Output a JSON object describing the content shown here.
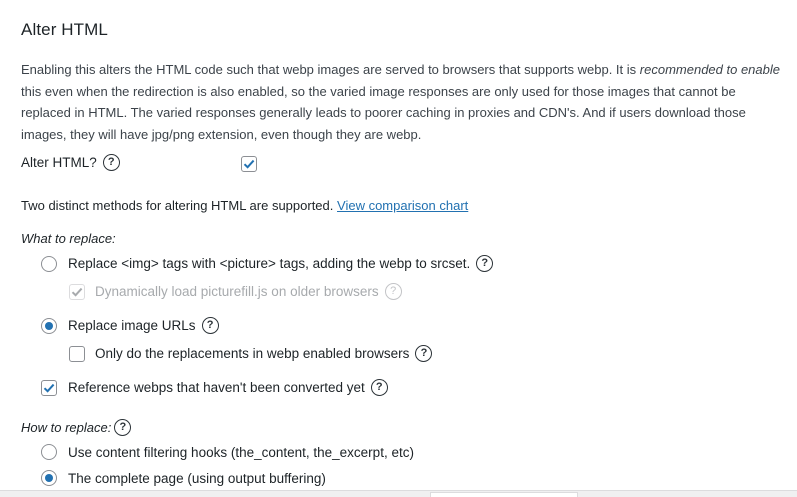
{
  "section": {
    "title": "Alter HTML",
    "description_parts": {
      "before": "Enabling this alters the HTML code such that webp images are served to browsers that supports webp. It is ",
      "emphasis": "recommended to enable",
      "after": " this even when the redirection is also enabled, so the varied image responses are only used for those images that cannot be replaced in HTML. The varied responses generally leads to poorer caching in proxies and CDN's. And if users download those images, they will have jpg/png extension, even though they are webp."
    }
  },
  "alter_html": {
    "label": "Alter HTML?",
    "help": "?",
    "checked": true
  },
  "methods": {
    "text": "Two distinct methods for altering HTML are supported.",
    "link": "View comparison chart"
  },
  "what_to_replace": {
    "heading": "What to replace:",
    "picture_option": {
      "label": "Replace <img> tags with <picture> tags, adding the webp to srcset.",
      "help": "?",
      "selected": false
    },
    "picturefill": {
      "label": "Dynamically load picturefill.js on older browsers",
      "help": "?",
      "checked": true,
      "disabled": true
    },
    "urls_option": {
      "label": "Replace image URLs",
      "help": "?",
      "selected": true
    },
    "only_webp_browsers": {
      "label": "Only do the replacements in webp enabled browsers",
      "help": "?",
      "checked": false
    },
    "reference_unconverted": {
      "label": "Reference webps that haven't been converted yet",
      "help": "?",
      "checked": true
    }
  },
  "how_to_replace": {
    "heading": "How to replace:",
    "help": "?",
    "options": [
      {
        "label": "Use content filtering hooks (the_content, the_excerpt, etc)",
        "selected": false
      },
      {
        "label": "The complete page (using output buffering)",
        "selected": true
      }
    ]
  },
  "colors": {
    "accent": "#2271b1",
    "text": "#1d2327",
    "muted": "#a7aaad"
  }
}
